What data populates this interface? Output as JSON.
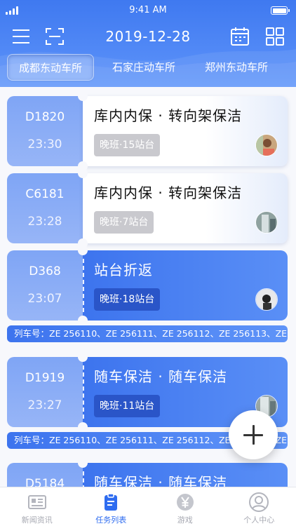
{
  "status_bar": {
    "time": "9:41 AM"
  },
  "header": {
    "date": "2019-12-28",
    "icons": {
      "menu": "menu-icon",
      "scan": "scan-icon",
      "calendar": "calendar-icon",
      "grid": "grid-icon"
    }
  },
  "depots": [
    {
      "label": "成都东动车所",
      "active": true
    },
    {
      "label": "石家庄动车所",
      "active": false
    },
    {
      "label": "郑州东动车所",
      "active": false
    }
  ],
  "tasks": [
    {
      "train": "D1820",
      "time": "23:30",
      "title": "库内内保 · 转向架保洁",
      "shift": "晚班·15站台",
      "style": "white",
      "avatar": "avatar-1"
    },
    {
      "train": "C6181",
      "time": "23:28",
      "title": "库内内保 · 转向架保洁",
      "shift": "晚班·7站台",
      "style": "white",
      "avatar": "avatar-2"
    },
    {
      "train": "D368",
      "time": "23:07",
      "title": "站台折返",
      "shift": "晚班·18站台",
      "style": "blue",
      "avatar": "avatar-3",
      "train_list": "列车号：ZE 256110、ZE 256111、ZE 256112、ZE 256113、ZE"
    },
    {
      "train": "D1919",
      "time": "23:27",
      "title": "随车保洁 · 随车保洁",
      "shift": "晚班·11站台",
      "style": "blue",
      "avatar": "avatar-4",
      "train_list": "列车号：ZE 256110、ZE 256111、ZE 256112、ZE 256113、ZE"
    },
    {
      "train": "D5184",
      "time": "",
      "title": "随车保洁 · 随车保洁",
      "shift": "",
      "style": "blue",
      "avatar": ""
    }
  ],
  "fab": {
    "icon": "plus-icon"
  },
  "tabbar": [
    {
      "label": "新闻资讯",
      "icon": "news-icon",
      "active": false
    },
    {
      "label": "任务列表",
      "icon": "task-list-icon",
      "active": true
    },
    {
      "label": "游戏",
      "icon": "yen-icon",
      "active": false
    },
    {
      "label": "个人中心",
      "icon": "profile-icon",
      "active": false
    }
  ],
  "colors": {
    "primary": "#3d74ee",
    "accent_light": "#97b5f7",
    "active_tab": "#2e6cf0"
  }
}
